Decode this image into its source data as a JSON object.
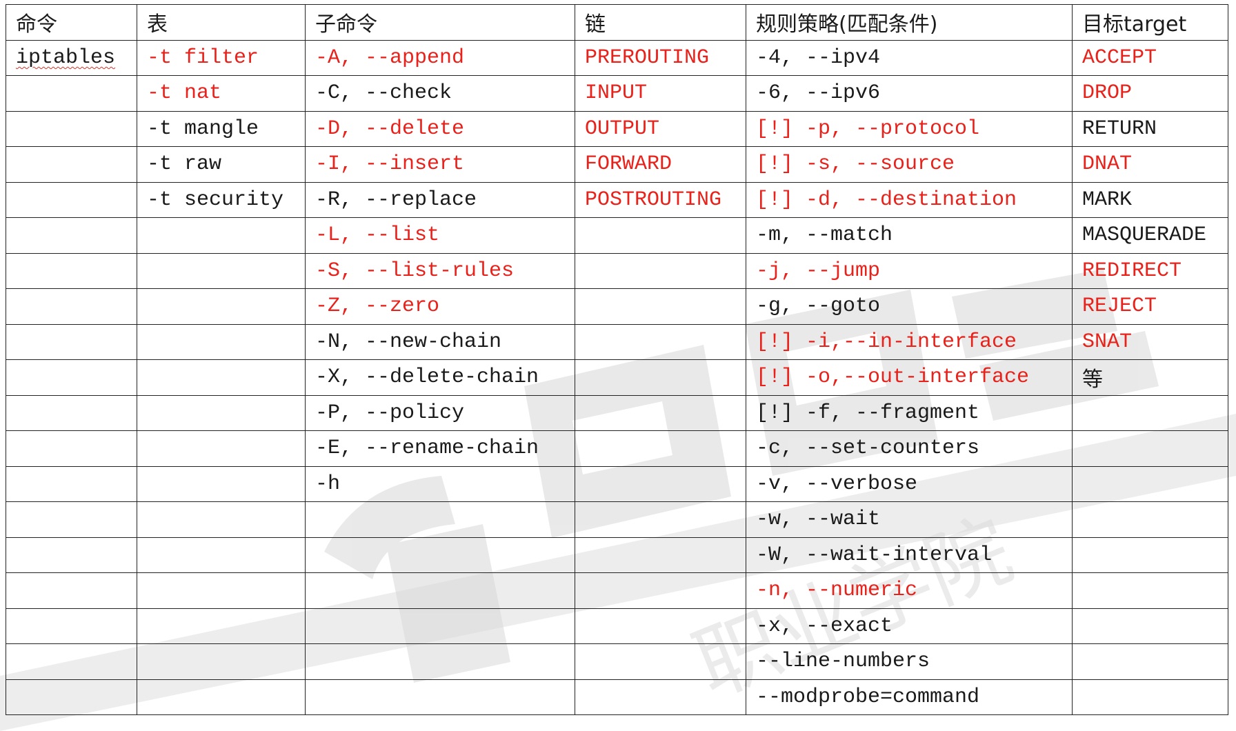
{
  "table": {
    "headers": [
      "命令",
      "表",
      "子命令",
      "链",
      "规则策略(匹配条件)",
      "目标target"
    ],
    "columns": {
      "command": [
        {
          "text": "iptables",
          "red": false,
          "squiggle": true
        }
      ],
      "table": [
        {
          "text": "-t filter",
          "red": true
        },
        {
          "text": "-t nat",
          "red": true
        },
        {
          "text": "-t mangle",
          "red": false
        },
        {
          "text": "-t raw",
          "red": false
        },
        {
          "text": "-t security",
          "red": false
        }
      ],
      "subcommand": [
        {
          "text": "-A, --append",
          "red": true
        },
        {
          "text": "-C, --check",
          "red": false
        },
        {
          "text": "-D, --delete",
          "red": true
        },
        {
          "text": "-I, --insert",
          "red": true
        },
        {
          "text": "-R, --replace",
          "red": false
        },
        {
          "text": "-L, --list",
          "red": true
        },
        {
          "text": "-S, --list-rules",
          "red": true
        },
        {
          "text": "-Z, --zero",
          "red": true
        },
        {
          "text": "-N, --new-chain",
          "red": false
        },
        {
          "text": "-X, --delete-chain",
          "red": false
        },
        {
          "text": "-P, --policy",
          "red": false
        },
        {
          "text": "-E, --rename-chain",
          "red": false
        },
        {
          "text": "-h",
          "red": false
        }
      ],
      "chain": [
        {
          "text": "PREROUTING",
          "red": true
        },
        {
          "text": "INPUT",
          "red": true
        },
        {
          "text": "OUTPUT",
          "red": true
        },
        {
          "text": "FORWARD",
          "red": true
        },
        {
          "text": "POSTROUTING",
          "red": true
        }
      ],
      "rule": [
        {
          "text": "-4, --ipv4",
          "red": false
        },
        {
          "text": "-6, --ipv6",
          "red": false
        },
        {
          "text": "[!] -p, --protocol",
          "red": true
        },
        {
          "text": "[!] -s, --source",
          "red": true
        },
        {
          "text": "[!] -d, --destination",
          "red": true
        },
        {
          "text": "-m, --match",
          "red": false
        },
        {
          "text": "-j, --jump",
          "red": true
        },
        {
          "text": "-g, --goto",
          "red": false
        },
        {
          "text": "[!] -i,--in-interface",
          "red": true
        },
        {
          "text": "[!] -o,--out-interface",
          "red": true
        },
        {
          "text": "[!] -f, --fragment",
          "red": false
        },
        {
          "text": "-c, --set-counters",
          "red": false
        },
        {
          "text": "-v, --verbose",
          "red": false
        },
        {
          "text": "-w, --wait",
          "red": false
        },
        {
          "text": "-W, --wait-interval",
          "red": false
        },
        {
          "text": "-n, --numeric",
          "red": true
        },
        {
          "text": "-x, --exact",
          "red": false
        },
        {
          "text": "--line-numbers",
          "red": false
        },
        {
          "text": "--modprobe=command",
          "red": false
        }
      ],
      "target": [
        {
          "text": "ACCEPT",
          "red": true
        },
        {
          "text": "DROP",
          "red": true
        },
        {
          "text": "RETURN",
          "red": false
        },
        {
          "text": "DNAT",
          "red": true
        },
        {
          "text": "MARK",
          "red": false
        },
        {
          "text": "MASQUERADE",
          "red": false
        },
        {
          "text": "REDIRECT",
          "red": true
        },
        {
          "text": "REJECT",
          "red": true
        },
        {
          "text": "SNAT",
          "red": true
        },
        {
          "text": "等",
          "red": false
        }
      ]
    },
    "watermark_text": "职业学院"
  },
  "colors": {
    "highlight": "#e8221b",
    "text": "#1a1a1a",
    "border": "#222222",
    "watermark": "#d9d9d9"
  }
}
